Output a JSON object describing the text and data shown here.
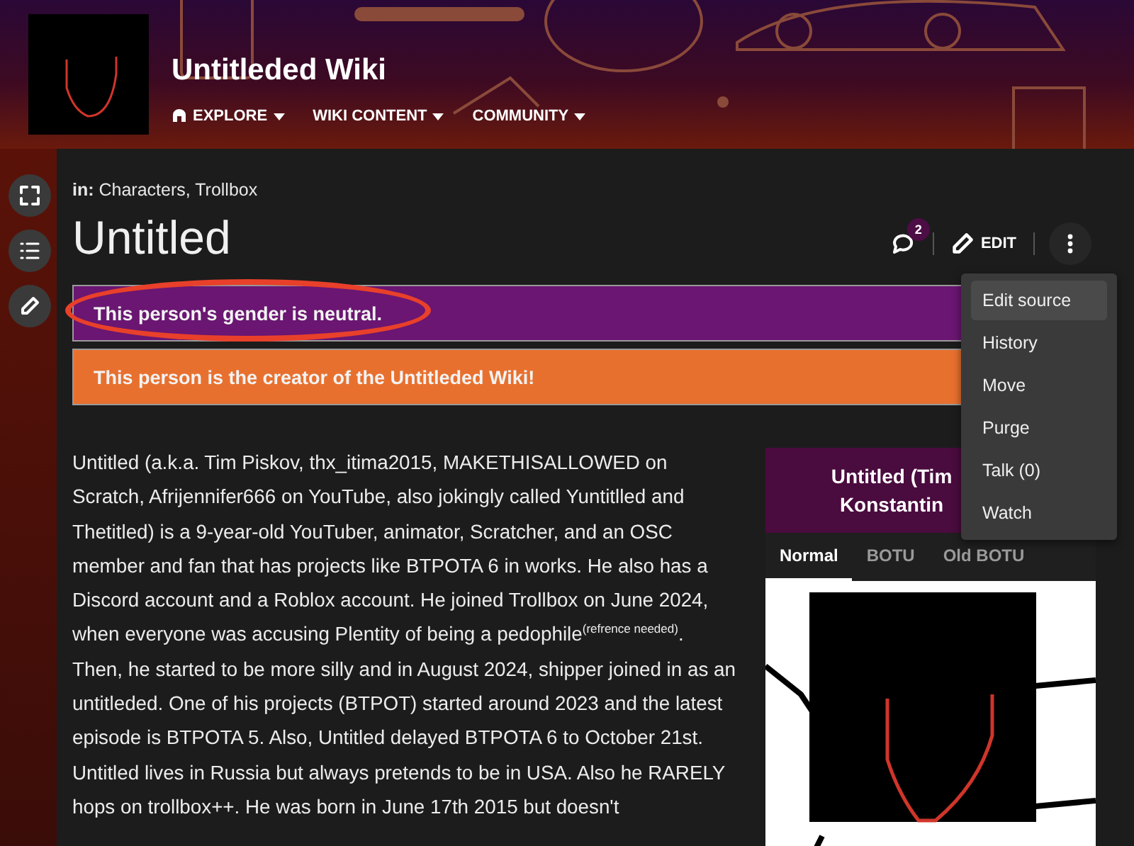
{
  "wiki": {
    "title": "Untitleded Wiki",
    "nav": [
      {
        "label": "EXPLORE",
        "kind": "explore"
      },
      {
        "label": "WIKI CONTENT",
        "kind": "plain"
      },
      {
        "label": "COMMUNITY",
        "kind": "plain"
      }
    ]
  },
  "rail": [
    {
      "kind": "fullscreen"
    },
    {
      "kind": "contents"
    },
    {
      "kind": "edit"
    }
  ],
  "breadcrumb": {
    "prefix": "in:",
    "categories": "Characters, Trollbox"
  },
  "page_title": "Untitled",
  "actions": {
    "comments_badge": "2",
    "edit": "EDIT"
  },
  "menu": [
    {
      "label": "Edit source",
      "selected": true
    },
    {
      "label": "History",
      "selected": false
    },
    {
      "label": "Move",
      "selected": false
    },
    {
      "label": "Purge",
      "selected": false
    },
    {
      "label": "Talk (0)",
      "selected": false
    },
    {
      "label": "Watch",
      "selected": false
    }
  ],
  "banners": [
    {
      "text": "This person's gender is neutral.",
      "color": "#6a1672",
      "circled": true
    },
    {
      "text": "This person is the creator of the Untitleded Wiki!",
      "color": "#e8702e",
      "circled": false
    }
  ],
  "body": "Untitled (a.k.a. Tim Piskov, thx_itima2015, MAKETHISALLOWED on Scratch, Afrijennifer666 on YouTube, also jokingly called Yuntitlled and Thetitled) is a 9-year-old YouTuber, animator, Scratcher, and an OSC member and fan that has projects like BTPOTA 6 in works. He also has a Discord account and a Roblox account. He joined Trollbox on June 2024, when everyone was accusing Plentity of being a pedophile$^{(refrence needed)}$. Then, he started to be more silly and in August 2024, shipper joined in as an untitleded. One of his projects (BTPOT) started around 2023 and the latest episode is BTPOTA 5. Also, Untitled delayed BTPOTA 6 to October 21st. Untitled lives in Russia but always pretends to be in USA. Also he RARELY hops on trollbox++. He was born in June 17th 2015 but doesn't",
  "infobox": {
    "title_lines": [
      "Untitled (Tim",
      "Konstantin"
    ],
    "tabs": [
      {
        "label": "Normal",
        "selected": true
      },
      {
        "label": "BOTU",
        "selected": false
      },
      {
        "label": "Old BOTU",
        "selected": false
      }
    ]
  }
}
